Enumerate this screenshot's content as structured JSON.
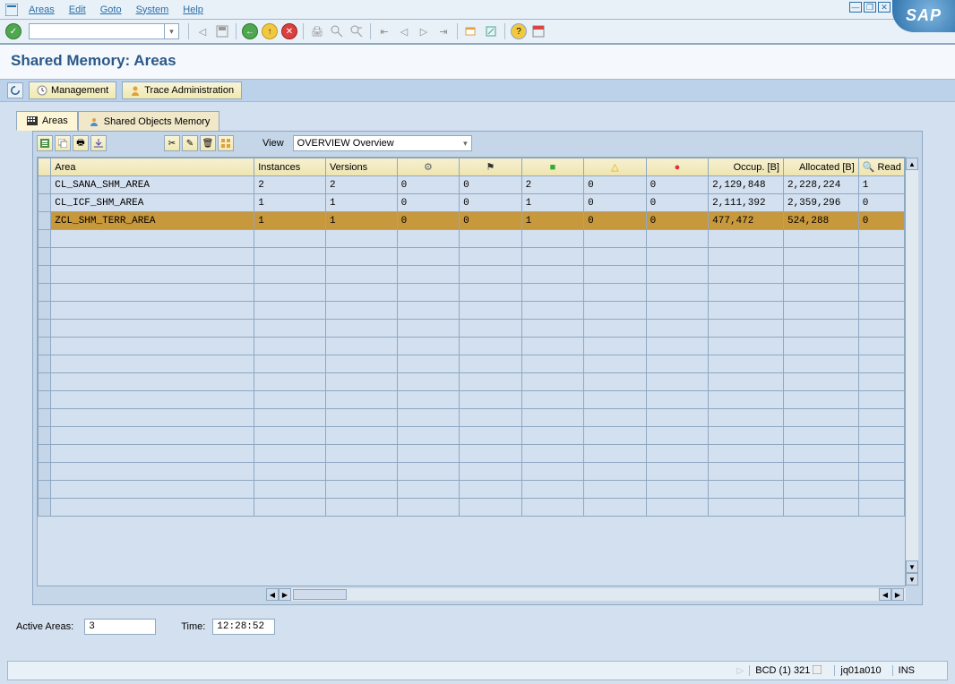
{
  "menu": {
    "areas": "Areas",
    "edit": "Edit",
    "goto": "Goto",
    "system": "System",
    "help": "Help"
  },
  "sap_logo": "SAP",
  "page_title": "Shared Memory: Areas",
  "actions": {
    "management": "Management",
    "trace_admin": "Trace Administration"
  },
  "tabs": {
    "areas": "Areas",
    "shared_obj": "Shared Objects Memory"
  },
  "view": {
    "label": "View",
    "value": "OVERVIEW Overview"
  },
  "table": {
    "headers": {
      "area": "Area",
      "instances": "Instances",
      "versions": "Versions",
      "gear": "⚙",
      "flag": "⚑",
      "green": "■",
      "yellow": "△",
      "red": "●",
      "occup": "Occup. [B]",
      "alloc": "Allocated [B]",
      "read": "Read"
    },
    "rows": [
      {
        "area": "CL_SANA_SHM_AREA",
        "instances": "2",
        "versions": "2",
        "gear": "0",
        "flag": "0",
        "green": "2",
        "yellow": "0",
        "red": "0",
        "occup": "2,129,848",
        "alloc": "2,228,224",
        "read": "1"
      },
      {
        "area": "CL_ICF_SHM_AREA",
        "instances": "1",
        "versions": "1",
        "gear": "0",
        "flag": "0",
        "green": "1",
        "yellow": "0",
        "red": "0",
        "occup": "2,111,392",
        "alloc": "2,359,296",
        "read": "0"
      },
      {
        "area": "ZCL_SHM_TERR_AREA",
        "instances": "1",
        "versions": "1",
        "gear": "0",
        "flag": "0",
        "green": "1",
        "yellow": "0",
        "red": "0",
        "occup": "477,472",
        "alloc": "524,288",
        "read": "0"
      }
    ]
  },
  "footer": {
    "active_label": "Active Areas:",
    "active_value": "3",
    "time_label": "Time:",
    "time_value": "12:28:52"
  },
  "status": {
    "client": "BCD (1) 321",
    "server": "jq01a010",
    "mode": "INS"
  }
}
